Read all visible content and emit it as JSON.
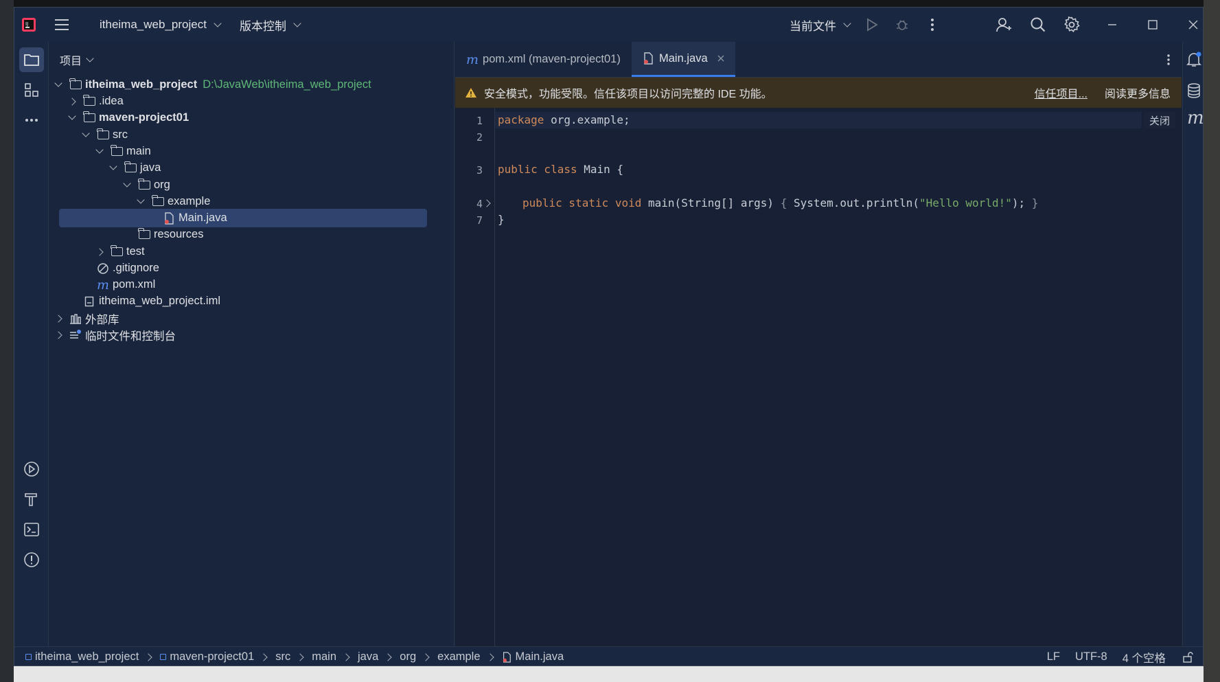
{
  "titlebar": {
    "project_name": "itheima_web_project",
    "vcs_label": "版本控制",
    "run_config": "当前文件"
  },
  "project_panel": {
    "title": "项目",
    "tree": [
      {
        "label": "itheima_web_project",
        "path": "D:\\JavaWeb\\itheima_web_project"
      },
      {
        "label": ".idea"
      },
      {
        "label": "maven-project01"
      },
      {
        "label": "src"
      },
      {
        "label": "main"
      },
      {
        "label": "java"
      },
      {
        "label": "org"
      },
      {
        "label": "example"
      },
      {
        "label": "Main.java"
      },
      {
        "label": "resources"
      },
      {
        "label": "test"
      },
      {
        "label": ".gitignore"
      },
      {
        "label": "pom.xml"
      },
      {
        "label": "itheima_web_project.iml"
      },
      {
        "label": "外部库"
      },
      {
        "label": "临时文件和控制台"
      }
    ]
  },
  "tabs": [
    {
      "label": "pom.xml (maven-project01)"
    },
    {
      "label": "Main.java"
    }
  ],
  "banner": {
    "message": "安全模式，功能受限。信任该项目以访问完整的 IDE 功能。",
    "trust_link": "信任项目...",
    "read_more": "阅读更多信息",
    "close": "关闭"
  },
  "code": {
    "line_numbers": [
      "1",
      "2",
      "3",
      "4",
      "7"
    ],
    "line1_kw": "package",
    "line1_rest": " org.example;",
    "line3_kw": "public class",
    "line3_rest": " Main {",
    "line4_kw": "public static void",
    "line4_mid": " main(String[] args) ",
    "line4_brace_open": "{",
    "line4_call": " System.out.println(",
    "line4_str": "\"Hello world!\"",
    "line4_end": ");",
    "line4_brace_close": " }",
    "line7": "}"
  },
  "statusbar": {
    "breadcrumbs": [
      "itheima_web_project",
      "maven-project01",
      "src",
      "main",
      "java",
      "org",
      "example",
      "Main.java"
    ],
    "line_sep": "LF",
    "encoding": "UTF-8",
    "indent": "4 个空格"
  }
}
